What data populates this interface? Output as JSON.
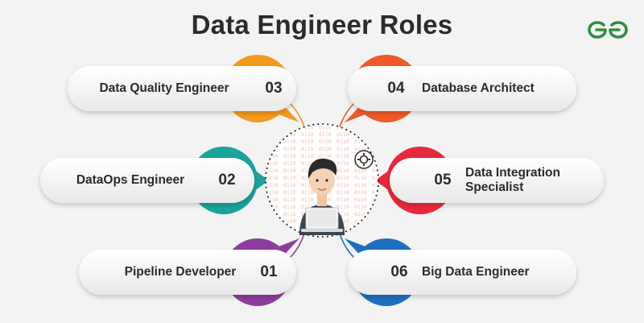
{
  "title": "Data Engineer Roles",
  "colors": {
    "background": "#f3f3f3",
    "title_text": "#2b2b2b",
    "logo_green": "#2f8d46",
    "orange": "#f39a1e",
    "orange_red": "#f05a28",
    "teal": "#1ba39c",
    "red": "#e8283c",
    "purple": "#8e3d9e",
    "blue": "#1f6fbf"
  },
  "logo": {
    "icon": "geeksforgeeks-logo-icon"
  },
  "center": {
    "icon": "data-engineer-at-laptop-illustration"
  },
  "roles": [
    {
      "number": "03",
      "label": "Data Quality Engineer",
      "color": "#f39a1e",
      "side": "left"
    },
    {
      "number": "04",
      "label": "Database Architect",
      "color": "#f05a28",
      "side": "right"
    },
    {
      "number": "02",
      "label": "DataOps Engineer",
      "color": "#1ba39c",
      "side": "left"
    },
    {
      "number": "05",
      "label": "Data Integration Specialist",
      "color": "#e8283c",
      "side": "right"
    },
    {
      "number": "01",
      "label": "Pipeline Developer",
      "color": "#8e3d9e",
      "side": "left"
    },
    {
      "number": "06",
      "label": "Big Data Engineer",
      "color": "#1f6fbf",
      "side": "right"
    }
  ]
}
